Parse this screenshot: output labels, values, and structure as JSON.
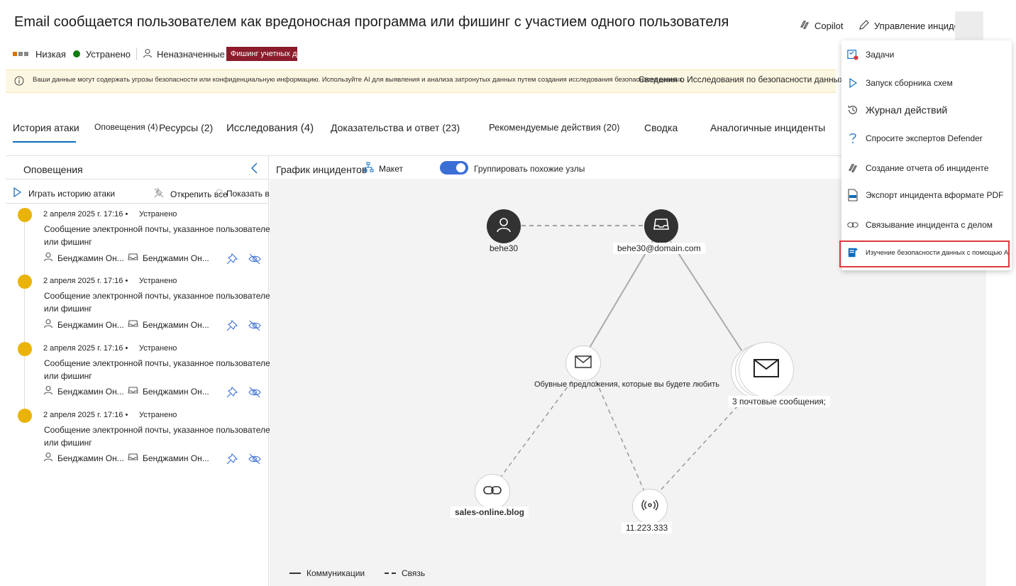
{
  "header": {
    "title": "Email сообщается пользователем как вредоносная программа или фишинг с участием одного пользователя",
    "copilot_label": "Copilot",
    "manage_label": "Управление инцидентом"
  },
  "meta": {
    "severity": "Низкая",
    "status": "Устранено",
    "assignee": "Неназначенные",
    "tag": "Фишинг учетных д"
  },
  "banner": {
    "text": "Ваши данные могут содержать угрозы безопасности или конфиденциальную информацию. Используйте AI для выявления и анализа затронутых данных путем создания исследования безопасности данных.",
    "link": "Сведения о Исследования по безопасности данных"
  },
  "tabs": {
    "t0": "История атаки",
    "t1": "Оповещения (4)",
    "t2": "Ресурсы (2)",
    "t3": "Исследования (4)",
    "t4": "Доказательства и ответ (23)",
    "t5": "Рекомендуемые действия (20)",
    "t6": "Сводка",
    "t7": "Аналогичные инциденты"
  },
  "alerts_pane": {
    "title": "Оповещения",
    "play": "Играть историю атаки",
    "unpin": "Открепить все",
    "show_all": "Показать все",
    "items": [
      {
        "date": "2 апреля 2025 г. 17:16 •",
        "status": "Устранено",
        "line1": "Сообщение электронной почты, указанное пользователем как вредоносная программа",
        "line2": "или фишинг",
        "user": "Бенджамин Он...",
        "mailbox": "Бенджамин Он..."
      },
      {
        "date": "2 апреля 2025 г. 17:16 •",
        "status": "Устранено",
        "line1": "Сообщение электронной почты, указанное пользователем как вредоносная программа",
        "line2": "или фишинг",
        "user": "Бенджамин Он...",
        "mailbox": "Бенджамин Он..."
      },
      {
        "date": "2 апреля 2025 г. 17:16 •",
        "status": "Устранено",
        "line1": "Сообщение электронной почты, указанное пользователем как вредоносная программа",
        "line2": "или фишинг",
        "user": "Бенджамин Он...",
        "mailbox": "Бенджамин Он..."
      },
      {
        "date": "2 апреля 2025 г. 17:16 •",
        "status": "Устранено",
        "line1": "Сообщение электронной почты, указанное пользователем как вредоносная программа",
        "line2": "или фишинг",
        "user": "Бенджамин Он...",
        "mailbox": "Бенджамин Он..."
      }
    ]
  },
  "graph": {
    "title": "График инцидентов",
    "layout": "Макет",
    "group_label": "Группировать похожие узлы",
    "group_enabled": true,
    "nodes": {
      "user": "behe30",
      "mailbox": "behe30@domain.com",
      "email1": "Обувные предложения, которые вы будете любить",
      "emails": "3 почтовые сообщения;",
      "url": "sales-online.blog",
      "ip": "11.223.333"
    },
    "legend_comm": "Коммуникации",
    "legend_link": "Связь"
  },
  "menu": {
    "items": [
      {
        "label": "Задачи",
        "icon": "tasks-icon"
      },
      {
        "label": "Запуск сборника схем",
        "icon": "play-icon"
      },
      {
        "label": "Журнал действий",
        "icon": "history-icon"
      },
      {
        "label": "Спросите экспертов Defender",
        "icon": "question-icon"
      },
      {
        "label": "Создание отчета об инциденте",
        "icon": "copilot-icon"
      },
      {
        "label": "Экспорт инцидента вформате PDF",
        "icon": "pdf-icon"
      },
      {
        "label": "Связывание инцидента с делом",
        "icon": "link-icon"
      },
      {
        "label": "Изучение безопасности данных с помощью AI",
        "icon": "ai-security-icon"
      }
    ]
  },
  "colors": {
    "accent": "#0f6cbd",
    "severity_low": "#d9730d",
    "resolved_green": "#107c10",
    "tag_bg": "#8a1c2b",
    "alert_dot": "#eab308",
    "highlight_border": "#e0393e"
  }
}
